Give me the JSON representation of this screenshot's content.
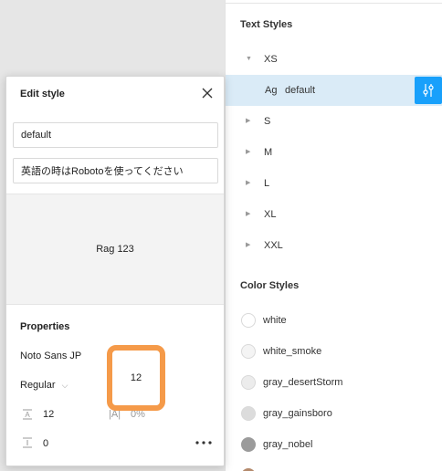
{
  "styles_panel": {
    "text_styles_title": "Text Styles",
    "text_groups": [
      {
        "label": "XS",
        "expanded": true
      },
      {
        "label": "S",
        "expanded": false
      },
      {
        "label": "M",
        "expanded": false
      },
      {
        "label": "L",
        "expanded": false
      },
      {
        "label": "XL",
        "expanded": false
      },
      {
        "label": "XXL",
        "expanded": false
      }
    ],
    "selected_style": {
      "prefix": "Ag",
      "label": "default"
    },
    "color_styles_title": "Color Styles",
    "colors": [
      {
        "label": "white",
        "hex": "#ffffff"
      },
      {
        "label": "white_smoke",
        "hex": "#f4f4f4"
      },
      {
        "label": "gray_desertStorm",
        "hex": "#ececec"
      },
      {
        "label": "gray_gainsboro",
        "hex": "#dcdcdc"
      },
      {
        "label": "gray_nobel",
        "hex": "#9b9b9b"
      }
    ],
    "accent": "#18a0fb",
    "selected_bg": "#daebf7"
  },
  "dialog": {
    "title": "Edit style",
    "name_value": "default",
    "description_value": "英語の時はRobotoを使ってください",
    "preview_text": "Rag 123",
    "properties_title": "Properties",
    "font_family": "Noto Sans JP",
    "font_weight": "Regular",
    "font_size": "12",
    "line_height": "12",
    "letter_spacing": "0%",
    "paragraph_spacing": "0",
    "highlight_color": "#f59a49"
  }
}
